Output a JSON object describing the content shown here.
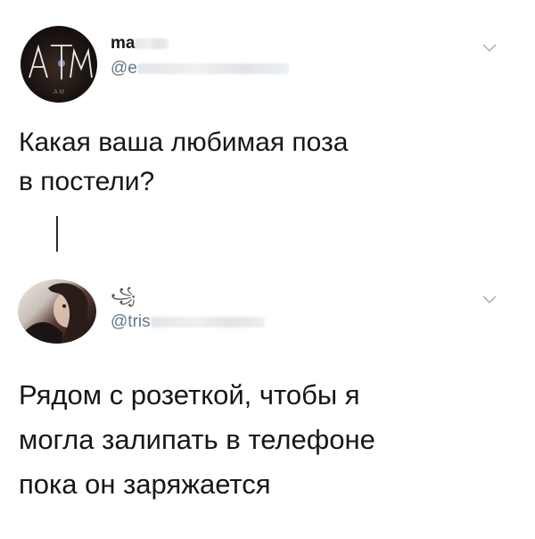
{
  "tweets": [
    {
      "author_name": "ma",
      "handle": "@e",
      "text": "Какая ваша любимая поза\nв постели?",
      "avatar_text": "A M",
      "icons": {
        "menu": "chevron-down-icon"
      }
    },
    {
      "author_symbol": "꧁",
      "handle": "@tris",
      "text": "Рядом с розеткой, чтобы я\nмогла залипать в телефоне\nпока он заряжается",
      "icons": {
        "menu": "chevron-down-icon"
      }
    }
  ],
  "colors": {
    "text": "#14171a",
    "secondary": "#657786",
    "chevron": "#aab8c2"
  }
}
